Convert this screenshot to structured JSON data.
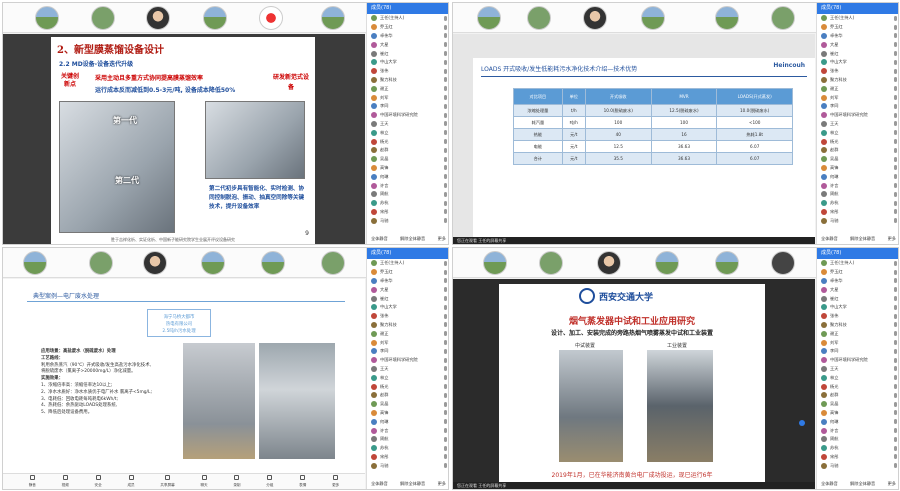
{
  "quad1": {
    "slide_title": "2、新型膜蒸馏设备设计",
    "subtitle": "2.2 MD设备-设备迭代升级",
    "key_label": "关键创新点",
    "line1": "采用主动且多重方式协同提高膜蒸馏效率",
    "line2": "运行成本反而减低到0.5-3元/吨, 设备成本降低50%",
    "right_label": "研发新范式设备",
    "gen1": "第一代",
    "gen2": "第二代",
    "bullet": "第二代初步具有智能化、实时检测、协同控制脱泡、振动、抽真空同除等关键技术，提升设备效率",
    "page_num": "9",
    "caption": "胜于吉祥化析、实证化析、中国新子能研究院学生业展开评议设备研究"
  },
  "quad2": {
    "slide_title": "LOADS 开式吸收/发生低能耗污水净化技术介绍—技术优势",
    "logo": "Heincouh",
    "table": [
      [
        "对比项目",
        "单位",
        "开式吸收",
        "MVR",
        "LOADS(开式蒸发)"
      ],
      [
        "浓缩处理量",
        "t/h",
        "10.0(脱硫废水)",
        "12.5(脱硫废水)",
        "10.0(脱硫废水)"
      ],
      [
        "耗汽量",
        "吨/h",
        "100",
        "100",
        "<100"
      ],
      [
        "热能",
        "元/t",
        "40",
        "16",
        "热耗1.8t"
      ],
      [
        "电能",
        "元/t",
        "12.5",
        "36.63",
        "6.07"
      ],
      [
        "合计",
        "元/t",
        "35.5",
        "36.63",
        "6.07"
      ]
    ]
  },
  "quad3": {
    "slide_title": "典型案例—电厂废水处理",
    "box": [
      "海宁马桥大都市",
      "热电有限公司",
      "2.5吨/h污水处理"
    ],
    "body": [
      "应用场景：高盐废水（脱硫废水）处理",
      "工艺路线：",
      "利用余热蒸汽（90℃）开式吸收/发生高盐污水净化技术,",
      "将脱硫废水（氯离子>20000mg/L）净化减量。",
      "实施效果：",
      "1、浓缩倍率高：浓缩倍率达10以上;",
      "2、净水水质好：净水水质优于电厂补水 氯离子<5mg/L;",
      "3、电耗低：回收电耗每吨耗电6kWh/t;",
      "4、热耗低：余热驱动LOADS处理系统,",
      "5、降低后处理设备费用。"
    ]
  },
  "quad4": {
    "univ": "西安交通大学",
    "slide_title": "烟气蒸发器中试和工业应用研究",
    "subtitle": "设计、加工、安装完成的旁路热烟气喷雾蒸发中试和工业装置",
    "label_left": "中试装置",
    "label_right": "工业装置",
    "footer": "2019年1月，已在华能济南黄台电厂成功投运，现已运行6年"
  },
  "common": {
    "participants_header": "成员(78)",
    "names": [
      "王任(主持人)",
      "乔玉红",
      "卓伟华",
      "大星",
      "崔红",
      "中山大学",
      "张伟",
      "聚力科技",
      "谢正",
      "刘军",
      "李同",
      "中国环境科学研究院",
      "王天",
      "林立",
      "杨光",
      "赵群",
      "吴晶",
      "高锋",
      "何琳",
      "许言",
      "周航",
      "苏杭",
      "宋彤",
      "马驰"
    ],
    "mute_all": "全体静音",
    "unmute": "解除全体静音",
    "more": "更多",
    "sharing_bar": "您正在观看 王任的屏幕共享"
  },
  "toolbar": [
    "静音",
    "视频",
    "安全",
    "成员",
    "共享屏幕",
    "聊天",
    "录制",
    "分组",
    "表情",
    "更多"
  ]
}
